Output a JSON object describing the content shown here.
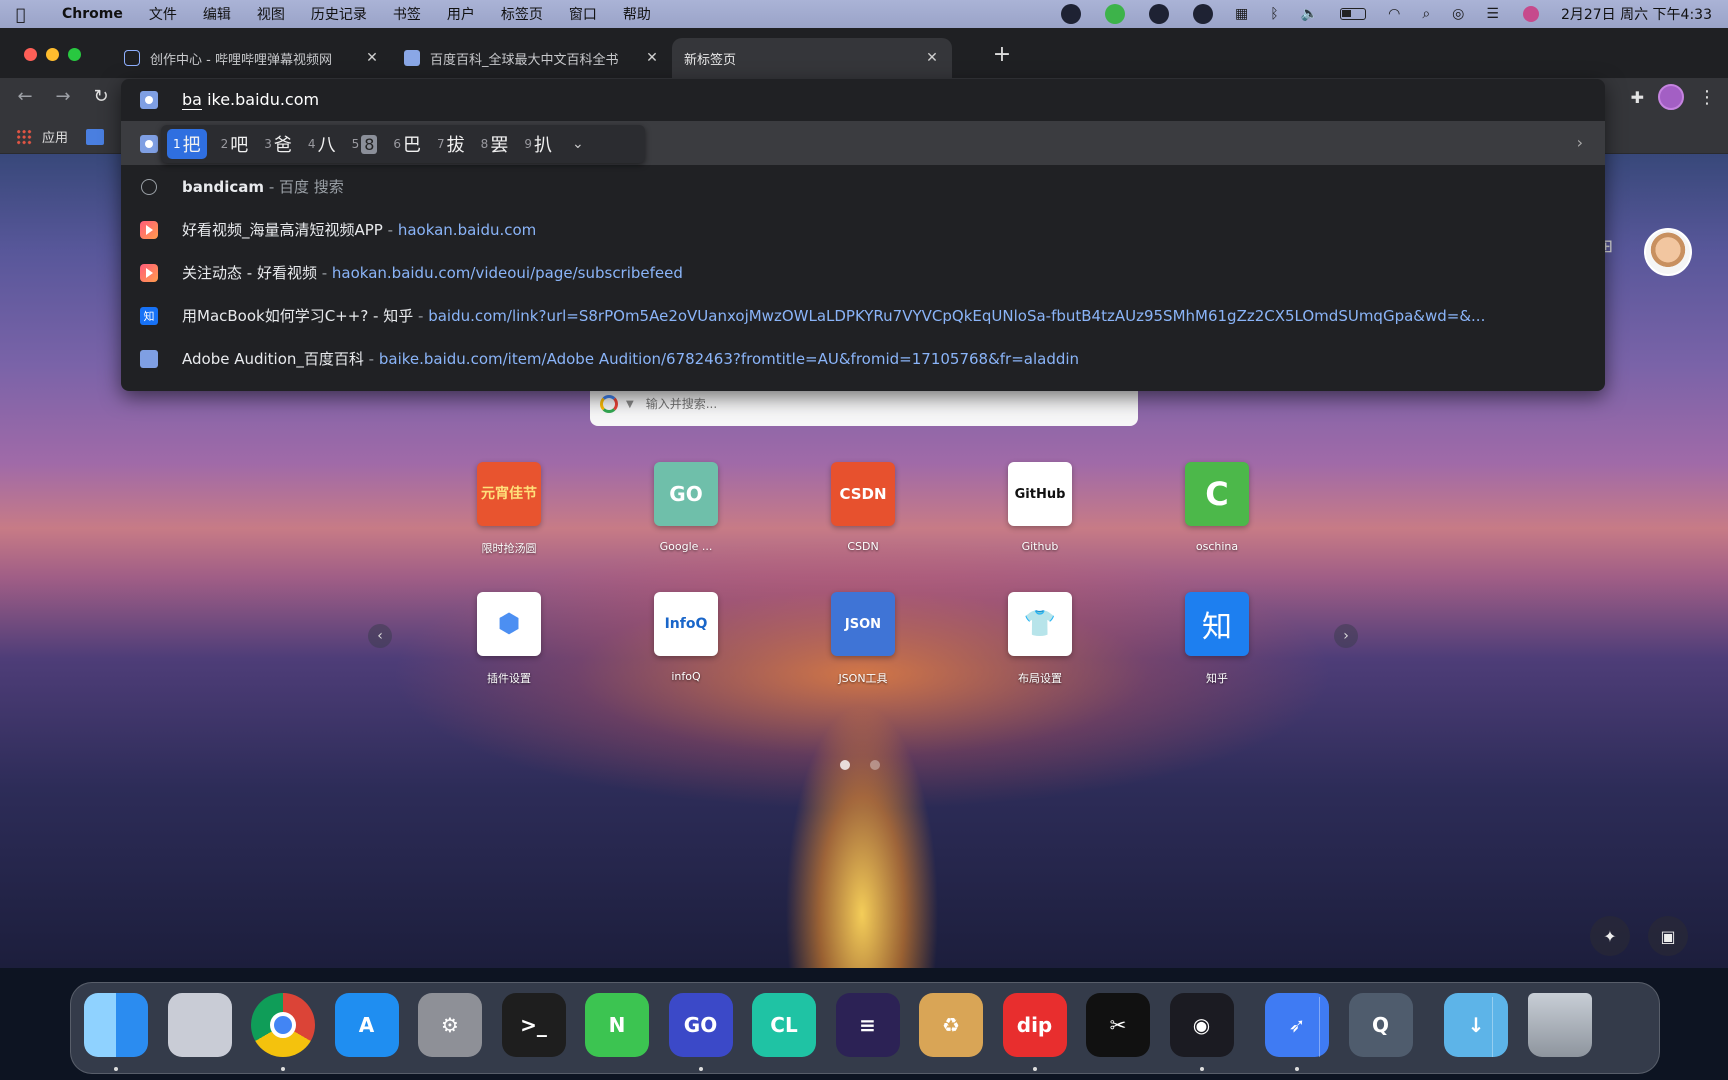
{
  "menubar": {
    "app_name": "Chrome",
    "items": [
      "文件",
      "编辑",
      "视图",
      "历史记录",
      "书签",
      "用户",
      "标签页",
      "窗口",
      "帮助"
    ],
    "clock": "2月27日 周六 下午4:33"
  },
  "tabs": [
    {
      "title": "创作中心 - 哔哩哔哩弹幕视频网",
      "close": "✕"
    },
    {
      "title": "百度百科_全球最大中文百科全书",
      "close": "✕"
    },
    {
      "title": "新标签页",
      "close": "✕"
    }
  ],
  "newtab_symbol": "+",
  "bookmarks": {
    "apps_label": "应用"
  },
  "omnibox": {
    "typed": "ba",
    "autocomplete": "ike.baidu.com",
    "ime_candidates": [
      {
        "num": "1",
        "text": "把"
      },
      {
        "num": "2",
        "text": "吧"
      },
      {
        "num": "3",
        "text": "爸"
      },
      {
        "num": "4",
        "text": "八"
      },
      {
        "num": "5",
        "text": "8"
      },
      {
        "num": "6",
        "text": "巴"
      },
      {
        "num": "7",
        "text": "拔"
      },
      {
        "num": "8",
        "text": "罢"
      },
      {
        "num": "9",
        "text": "扒"
      }
    ],
    "suggestions": [
      {
        "icon": "history-clock-icon",
        "title_bold": "bandicam",
        "sep": " - ",
        "desc": "百度 搜索",
        "url": ""
      },
      {
        "icon": "haokan-icon",
        "title_bold": "",
        "title": "好看视频_海量高清短视频APP",
        "sep": " - ",
        "desc": "",
        "url": "haokan.baidu.com"
      },
      {
        "icon": "haokan-icon",
        "title_bold": "",
        "title": "关注动态 - 好看视频",
        "sep": " - ",
        "desc": "",
        "url": "haokan.baidu.com/videoui/page/subscribefeed"
      },
      {
        "icon": "zhihu-icon",
        "title_bold": "",
        "title": "用MacBook如何学习C++? - 知乎",
        "sep": " - ",
        "desc": "",
        "url": "baidu.com/link?url=S8rPOm5Ae2oVUanxojMwzOWLaLDPKYRu7VYVCpQkEqUNloSa-fbutB4tzAUz95SMhM61gZz2CX5LOmdSUmqGpa&wd=&..."
      },
      {
        "icon": "baike-icon",
        "title_bold": "",
        "title": "Adobe Audition_百度百科",
        "sep": " - ",
        "desc": "",
        "url": "baike.baidu.com/item/Adobe Audition/6782463?fromtitle=AU&fromid=17105768&fr=aladdin"
      }
    ]
  },
  "ntp": {
    "search_placeholder": "输入并搜索...",
    "shortcuts_row1": [
      {
        "tile_text": "元宵佳节",
        "caption": "限时抢汤圆",
        "color": "#e8542f"
      },
      {
        "tile_text": "GO",
        "caption": "Google ...",
        "color": "#6fbfaa"
      },
      {
        "tile_text": "CSDN",
        "caption": "CSDN",
        "color": "#e7512e"
      },
      {
        "tile_text": "GitHub",
        "caption": "Github",
        "color": "#ffffff"
      },
      {
        "tile_text": "C",
        "caption": "oschina",
        "color": "#4cb84a"
      }
    ],
    "shortcuts_row2": [
      {
        "tile_text": "⬢",
        "caption": "插件设置",
        "color": "#ffffff"
      },
      {
        "tile_text": "InfoQ",
        "caption": "infoQ",
        "color": "#ffffff"
      },
      {
        "tile_text": "JSON",
        "caption": "JSON工具",
        "color": "#3f74d6"
      },
      {
        "tile_text": "👕",
        "caption": "布局设置",
        "color": "#ffffff"
      },
      {
        "tile_text": "知",
        "caption": "知乎",
        "color": "#1d7ff0"
      }
    ]
  },
  "dock": {
    "apps": [
      {
        "name": "finder",
        "label": "",
        "color": "#2b8cf0"
      },
      {
        "name": "launchpad",
        "label": "",
        "color": "#c9ccd6"
      },
      {
        "name": "chrome",
        "label": "",
        "color": "#ffffff"
      },
      {
        "name": "app-store",
        "label": "A",
        "color": "#1f8ef1"
      },
      {
        "name": "system-preferences",
        "label": "⚙",
        "color": "#8e9097"
      },
      {
        "name": "terminal",
        "label": ">_",
        "color": "#1e1e1e"
      },
      {
        "name": "notion-n",
        "label": "N",
        "color": "#3cc451"
      },
      {
        "name": "goland-eap",
        "label": "GO",
        "color": "#3b49c8"
      },
      {
        "name": "clion",
        "label": "CL",
        "color": "#1fc3a4"
      },
      {
        "name": "eclipse",
        "label": "≡",
        "color": "#2c2255"
      },
      {
        "name": "archive",
        "label": "♻",
        "color": "#d9a556"
      },
      {
        "name": "dip",
        "label": "dip",
        "color": "#e82e2e"
      },
      {
        "name": "capcut",
        "label": "✂",
        "color": "#111111"
      },
      {
        "name": "obs",
        "label": "◉",
        "color": "#1b1b22"
      },
      {
        "name": "feishu",
        "label": "➶",
        "color": "#3f7bf3"
      },
      {
        "name": "quicktime",
        "label": "Q",
        "color": "#4f5c6d"
      },
      {
        "name": "downloads",
        "label": "↓",
        "color": "#5db4e8"
      },
      {
        "name": "trash",
        "label": "",
        "color": "#9aa1aa"
      }
    ]
  }
}
